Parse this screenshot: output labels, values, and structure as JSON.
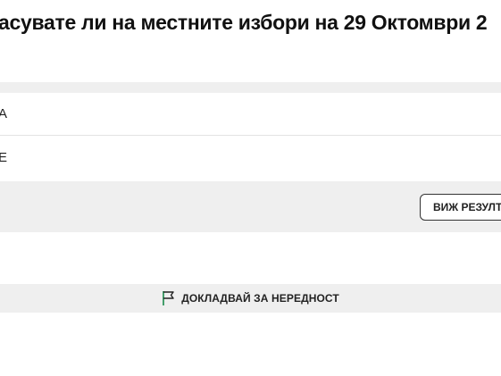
{
  "poll": {
    "question": "асувате ли на местните избори на 29 Октомври 2",
    "options": [
      {
        "label": "А"
      },
      {
        "label": "Е"
      }
    ],
    "results_button_label": "ВИЖ РЕЗУЛТ"
  },
  "report": {
    "label": "ДОКЛАДВАЙ ЗА НЕРЕДНОСТ",
    "icon": "flag-icon"
  }
}
